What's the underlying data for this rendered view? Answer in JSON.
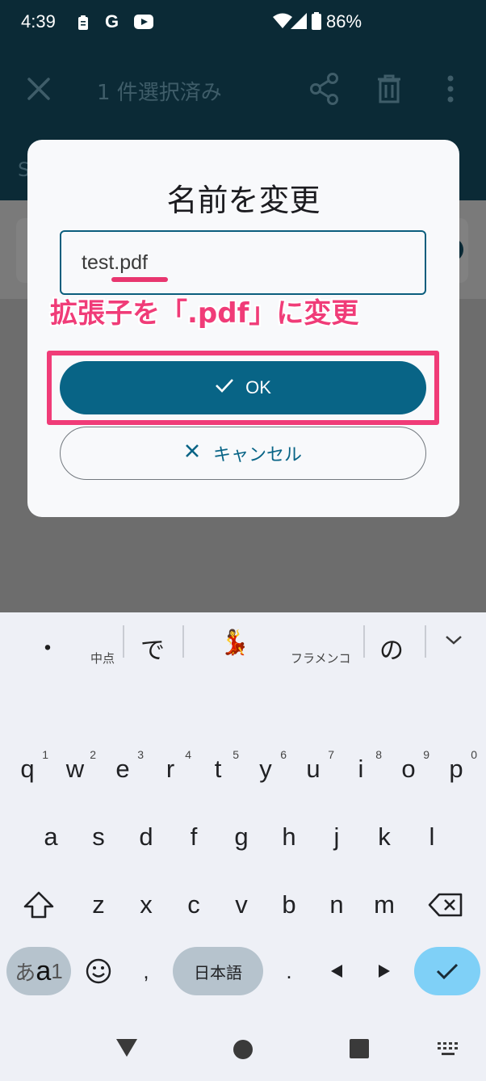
{
  "status": {
    "time": "4:39",
    "battery": "86%",
    "g_icon": "G"
  },
  "appbar": {
    "title": "1 件選択済み",
    "partial_text": "S"
  },
  "dialog": {
    "title": "名前を変更",
    "field_value": "test.pdf",
    "ok_label": "OK",
    "cancel_label": "キャンセル"
  },
  "annotation": {
    "note": "拡張子を「.pdf」に変更"
  },
  "suggestions": {
    "s1": "・",
    "s1_sub": "中点",
    "s2": "で",
    "s3": "💃",
    "s3_sub": "フラメンコ",
    "s4": "の"
  },
  "keyboard": {
    "row1": [
      [
        "q",
        "1"
      ],
      [
        "w",
        "2"
      ],
      [
        "e",
        "3"
      ],
      [
        "r",
        "4"
      ],
      [
        "t",
        "5"
      ],
      [
        "y",
        "6"
      ],
      [
        "u",
        "7"
      ],
      [
        "i",
        "8"
      ],
      [
        "o",
        "9"
      ],
      [
        "p",
        "0"
      ]
    ],
    "row2": [
      "a",
      "s",
      "d",
      "f",
      "g",
      "h",
      "j",
      "k",
      "l"
    ],
    "row3": [
      "z",
      "x",
      "c",
      "v",
      "b",
      "n",
      "m"
    ],
    "mode_label_1": "あ",
    "mode_label_2": "a",
    "mode_label_3": "1",
    "comma": ",",
    "space_label": "日本語",
    "period": "."
  },
  "colors": {
    "accent": "#086486",
    "highlight": "#f03c78",
    "appbar": "#0b2a36"
  }
}
